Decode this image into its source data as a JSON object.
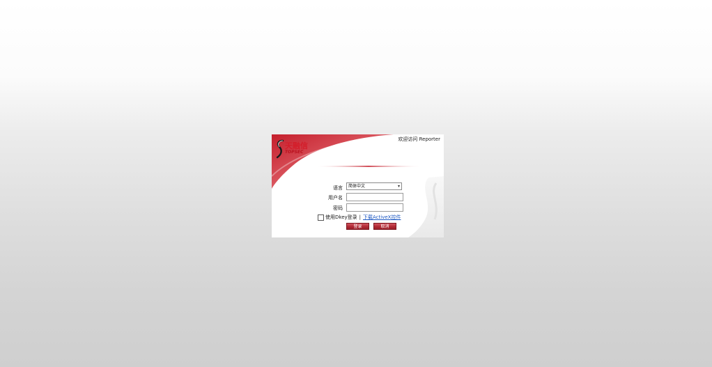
{
  "header": {
    "welcome_text": "欢迎访问 Reporter"
  },
  "logo": {
    "chinese_name": "天融信",
    "english_name": "TOPSEC"
  },
  "form": {
    "language_label": "语言",
    "language_value": "简体中文",
    "username_label": "用户名",
    "username_value": "",
    "password_label": "密码",
    "password_value": "",
    "dkey_label": "使用Dkey登录",
    "dkey_checked": false,
    "separator": "|",
    "download_link": "下载ActiveX控件"
  },
  "buttons": {
    "login": "登录",
    "cancel": "取消"
  },
  "colors": {
    "brand_red": "#c0202d",
    "button_red": "#b02a35",
    "link_blue": "#1c57c2"
  }
}
